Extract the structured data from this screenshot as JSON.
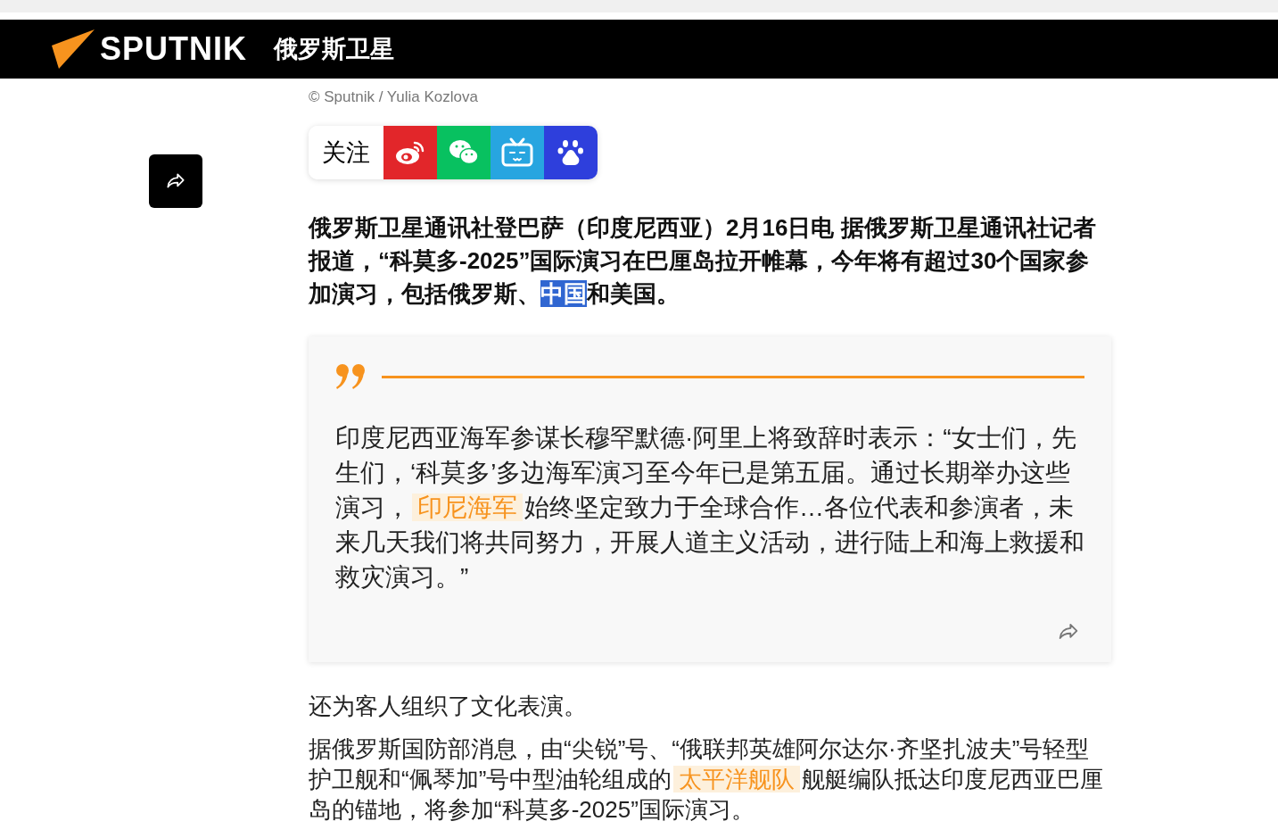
{
  "header": {
    "brand": "SPUTNIK",
    "title": "俄罗斯卫星"
  },
  "caption": "© Sputnik / Yulia Kozlova",
  "follow": {
    "label": "关注",
    "buttons": [
      {
        "kind": "weibo"
      },
      {
        "kind": "wechat"
      },
      {
        "kind": "bilibili"
      },
      {
        "kind": "baidu"
      }
    ]
  },
  "lead": [
    {
      "text": "俄罗斯卫星通讯社登巴萨（印度尼西亚）2月16日电 据俄罗斯卫星通讯社记者报道，“科莫多-2025”国际演习在巴厘岛拉开帷幕，今年将有超过30个国家参加演习，包括俄罗斯、",
      "selected": false
    },
    {
      "text": "中国",
      "selected": true
    },
    {
      "text": "和美国。",
      "selected": false
    }
  ],
  "quote": [
    {
      "kind": "text",
      "text": "印度尼西亚海军参谋长穆罕默德·阿里上将致辞时表示：“女士们，先生们，‘科莫多’多边海军演习至今年已是第五届。通过长期举办这些演习，"
    },
    {
      "kind": "link",
      "text": "印尼海军"
    },
    {
      "kind": "text",
      "text": "始终坚定致力于全球合作…各位代表和参演者，未来几天我们将共同努力，开展人道主义活动，进行陆上和海上救援和救灾演习。”"
    }
  ],
  "paragraphs": [
    [
      {
        "kind": "text",
        "text": "还为客人组织了文化表演。"
      }
    ],
    [
      {
        "kind": "text",
        "text": "据俄罗斯国防部消息，由“尖锐”号、“俄联邦英雄阿尔达尔·齐坚扎波夫”号轻型护卫舰和“佩琴加”号中型油轮组成的"
      },
      {
        "kind": "link",
        "text": "太平洋舰队"
      },
      {
        "kind": "text",
        "text": "舰艇编队抵达印度尼西亚巴厘岛的锚地，将参加“科莫多-2025”国际演习。"
      }
    ]
  ]
}
